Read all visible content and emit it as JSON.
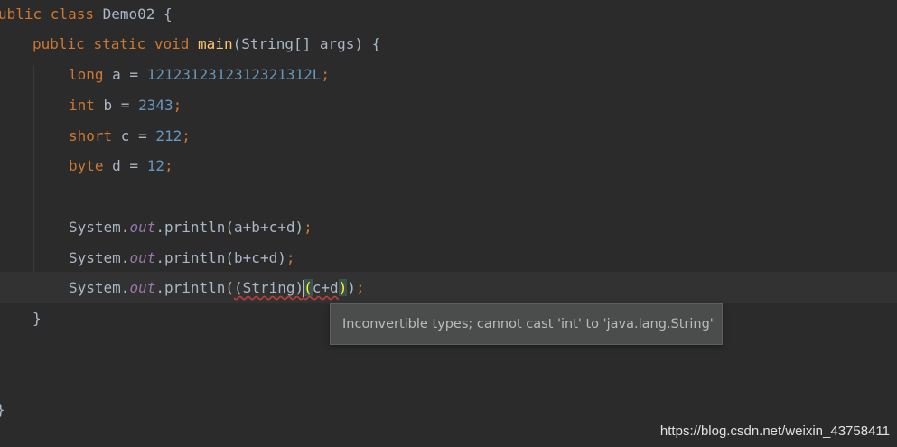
{
  "code": {
    "line_class": {
      "prefix": "ublic ",
      "kw_class": "class",
      "name": " Demo02 ",
      "brace": "{"
    },
    "line_main": {
      "kw_public": "public",
      "kw_static": "static",
      "kw_void": "void",
      "method": "main",
      "params": "(String[] args) {"
    },
    "line_a": {
      "type": "long",
      "decl": " a = ",
      "value": "1212312312312321312L",
      "semi": ";"
    },
    "line_b": {
      "type": "int",
      "decl": " b = ",
      "value": "2343",
      "semi": ";"
    },
    "line_c": {
      "type": "short",
      "decl": " c = ",
      "value": "212",
      "semi": ";"
    },
    "line_d": {
      "type": "byte",
      "decl": " d = ",
      "value": "12",
      "semi": ";"
    },
    "line_print1": {
      "obj": "System.",
      "field": "out",
      "call": ".println(a+b+c+d)",
      "semi": ";"
    },
    "line_print2": {
      "obj": "System.",
      "field": "out",
      "call": ".println(b+c+d)",
      "semi": ";"
    },
    "line_print3": {
      "obj": "System.",
      "field": "out",
      "call_start": ".println(",
      "cast": "(String)",
      "open_paren": "(",
      "expr": "c+d",
      "close_paren": ")",
      "call_end": ")",
      "semi": ";"
    },
    "close_method": "}",
    "close_class": "}"
  },
  "tooltip": {
    "message": "Inconvertible types; cannot cast 'int' to 'java.lang.String'"
  },
  "watermark": {
    "text": "https://blog.csdn.net/weixin_43758411"
  },
  "colors": {
    "background": "#2b2b2b",
    "keyword": "#cc7832",
    "number": "#6897bb",
    "method": "#ffc66d",
    "field": "#9876aa",
    "text": "#a9b7c6",
    "error_underline": "#bc3f3c",
    "tooltip_bg": "#4b4d4d"
  }
}
